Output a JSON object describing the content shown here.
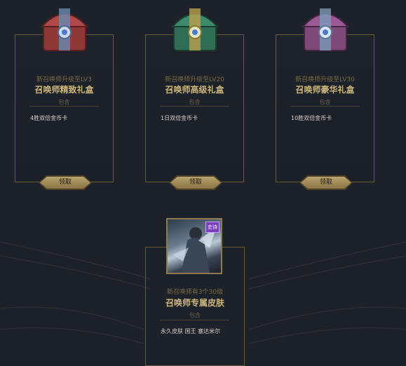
{
  "cards": [
    {
      "subtitle": "新召唤师升级至LV3",
      "title": "召唤师精致礼盒",
      "includes": "包含",
      "item": "4胜双倍金币卡",
      "button": "领取",
      "chest_color": "#b04a4a"
    },
    {
      "subtitle": "新召唤师升级至LV20",
      "title": "召唤师高级礼盒",
      "includes": "包含",
      "item": "1日双倍金币卡",
      "button": "领取",
      "chest_color": "#3f8a6a"
    },
    {
      "subtitle": "新召唤师升级至LV30",
      "title": "召唤师豪华礼盒",
      "includes": "包含",
      "item": "10胜双倍金币卡",
      "button": "领取",
      "chest_color": "#9a5a96"
    }
  ],
  "skin": {
    "subtitle": "新召唤师有3个30级",
    "title": "召唤师专属皮肤",
    "includes": "包含",
    "item": "永久皮肤 国王 塞达米尔",
    "badge": "史诗",
    "badge_color": "#7a3fb8"
  }
}
